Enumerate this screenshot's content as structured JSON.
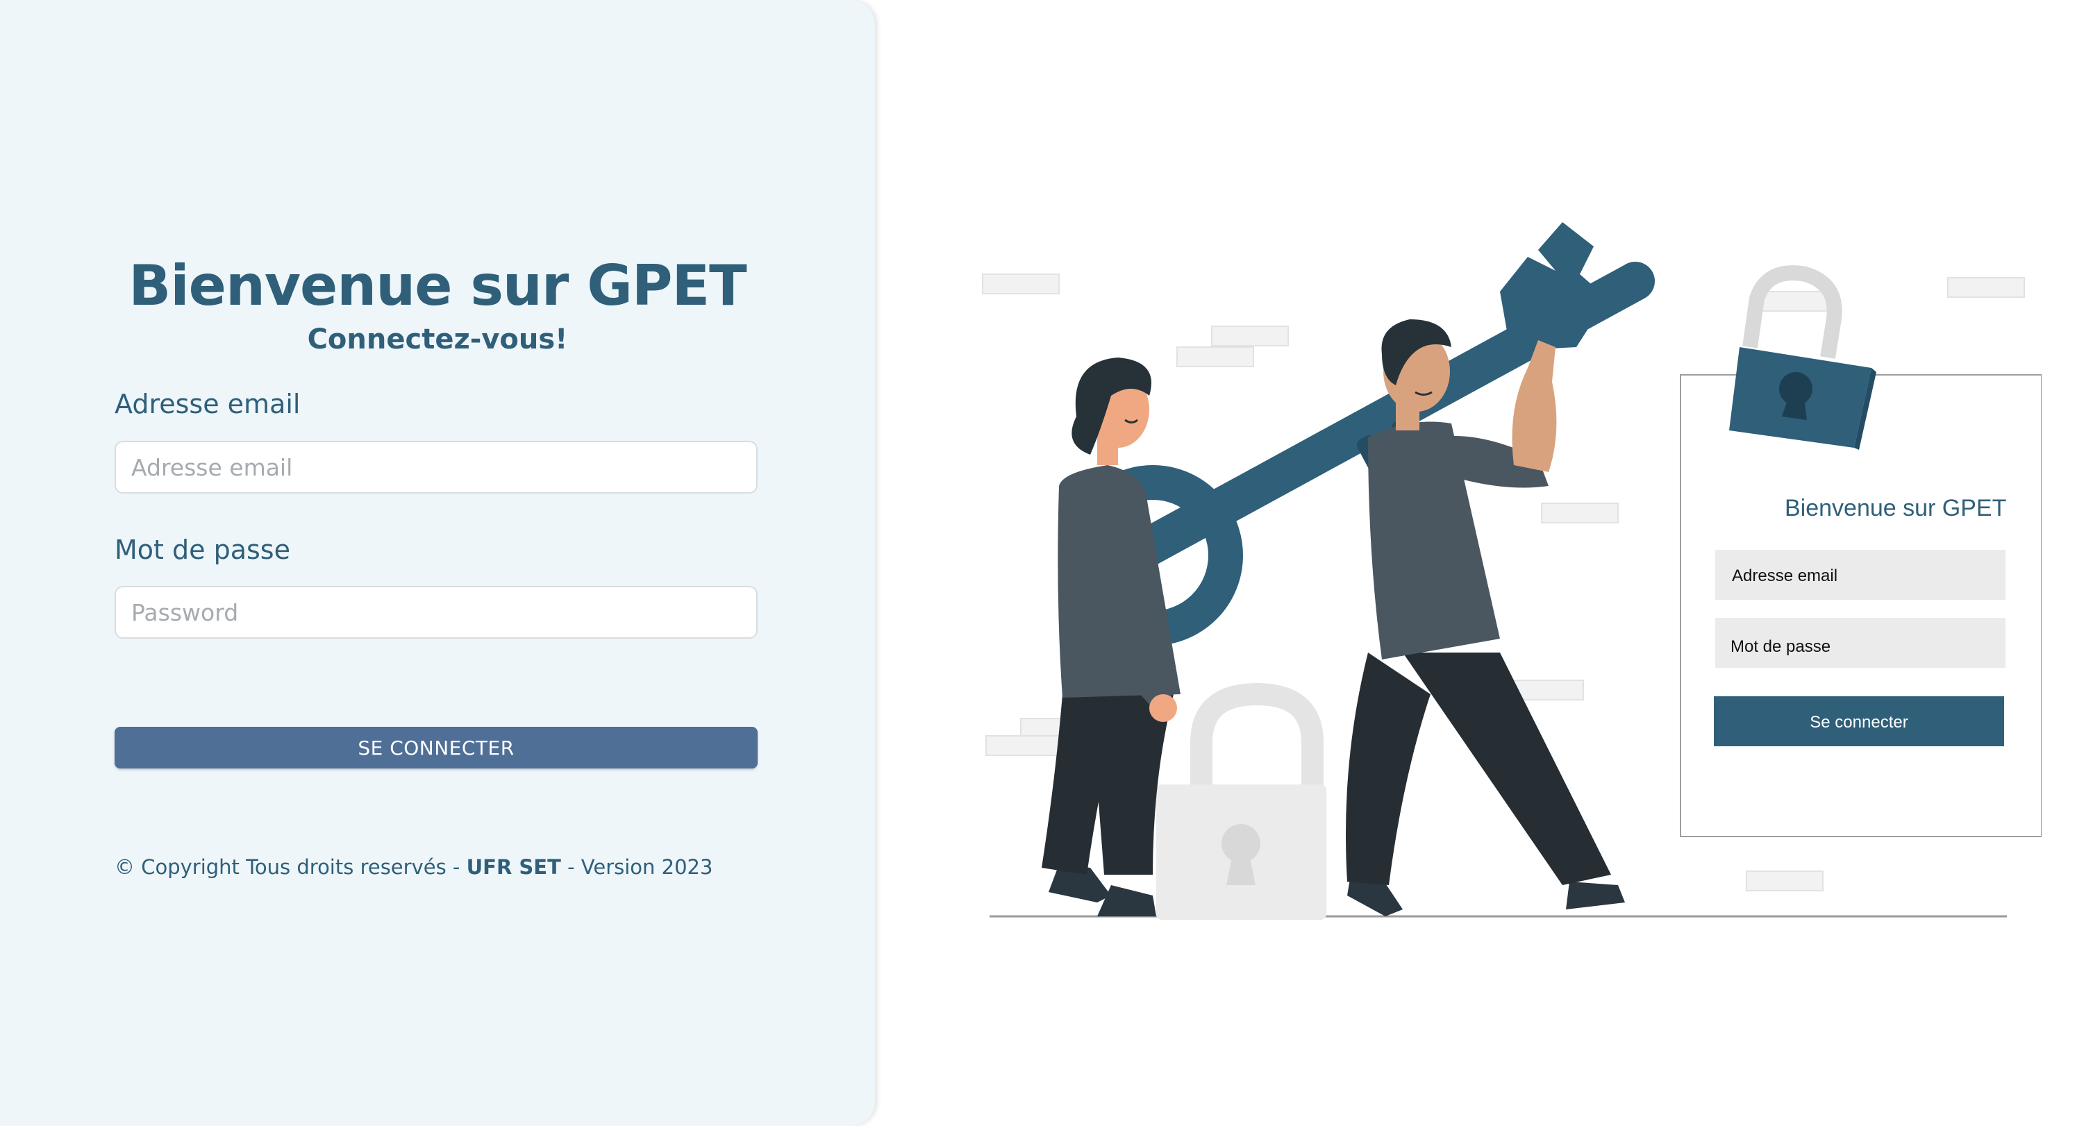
{
  "login": {
    "title": "Bienvenue sur GPET",
    "subtitle": "Connectez-vous!",
    "email_label": "Adresse email",
    "email_placeholder": "Adresse email",
    "email_value": "",
    "password_label": "Mot de passe",
    "password_placeholder": "Password",
    "password_value": "",
    "submit_label": "SE CONNECTER"
  },
  "footer": {
    "prefix": "© Copyright Tous droits reservés - ",
    "org": "UFR SET",
    "suffix": " - Version 2023"
  },
  "illustration": {
    "card_title": "Bienvenue sur GPET",
    "card_email": "Adresse email",
    "card_password": "Mot de passe",
    "card_button": "Se connecter"
  },
  "colors": {
    "primary": "#2f5f79",
    "button": "#4f6f96",
    "panel_bg": "#eef6fa"
  }
}
